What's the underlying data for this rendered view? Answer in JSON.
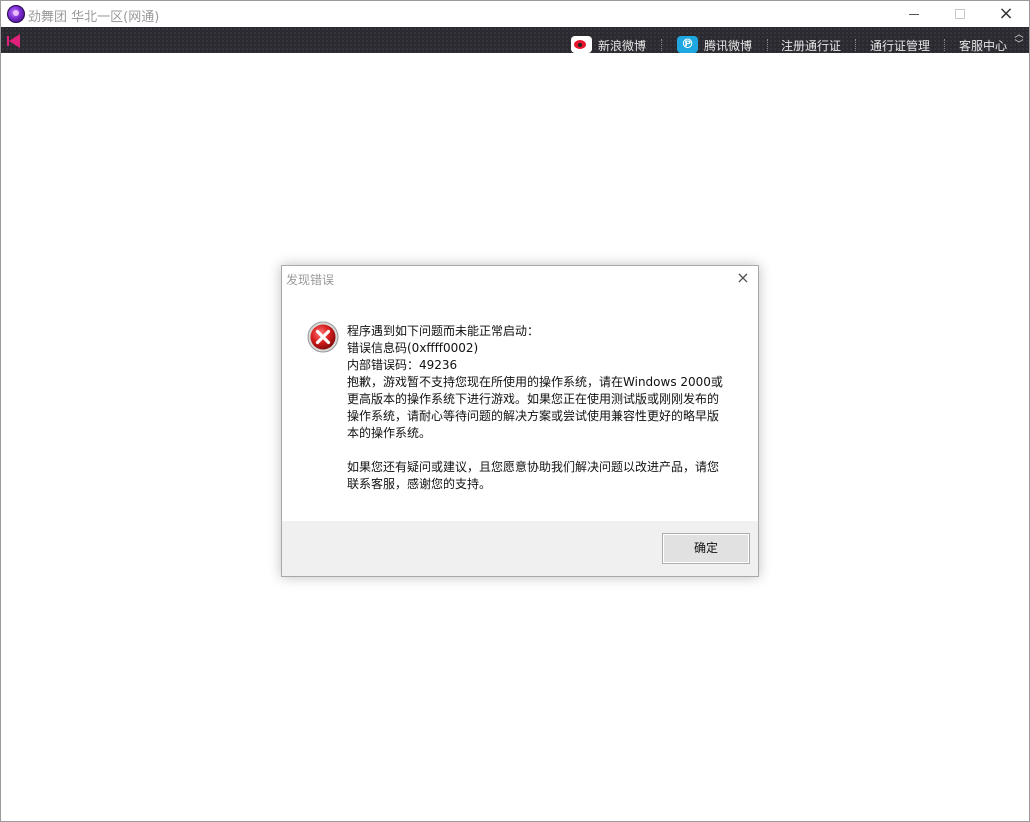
{
  "window": {
    "title": "劲舞团 华北一区(网通)",
    "controls": {
      "minimize": "minimize",
      "maximize": "maximize",
      "close": "×"
    }
  },
  "toolbar": {
    "links": [
      {
        "label": "新浪微博",
        "icon": "sina-weibo-icon"
      },
      {
        "label": "腾讯微博",
        "icon": "tencent-weibo-icon"
      },
      {
        "label": "注册通行证"
      },
      {
        "label": "通行证管理"
      },
      {
        "label": "客服中心"
      }
    ],
    "accent_color": "#e0207a"
  },
  "dialog": {
    "title": "发现错误",
    "close_label": "×",
    "icon": "error-icon",
    "lines": [
      "程序遇到如下问题而未能正常启动：",
      "错误信息码(0xffff0002)",
      "内部错误码：49236",
      "抱歉，游戏暂不支持您现在所使用的操作系统，请在Windows 2000或",
      "更高版本的操作系统下进行游戏。如果您正在使用测试版或刚刚发布的",
      "操作系统，请耐心等待问题的解决方案或尝试使用兼容性更好的略早版",
      "本的操作系统。"
    ],
    "lines2": [
      "如果您还有疑问或建议，且您愿意协助我们解决问题以改进产品，请您",
      "联系客服，感谢您的支持。"
    ],
    "ok_label": "确定"
  }
}
